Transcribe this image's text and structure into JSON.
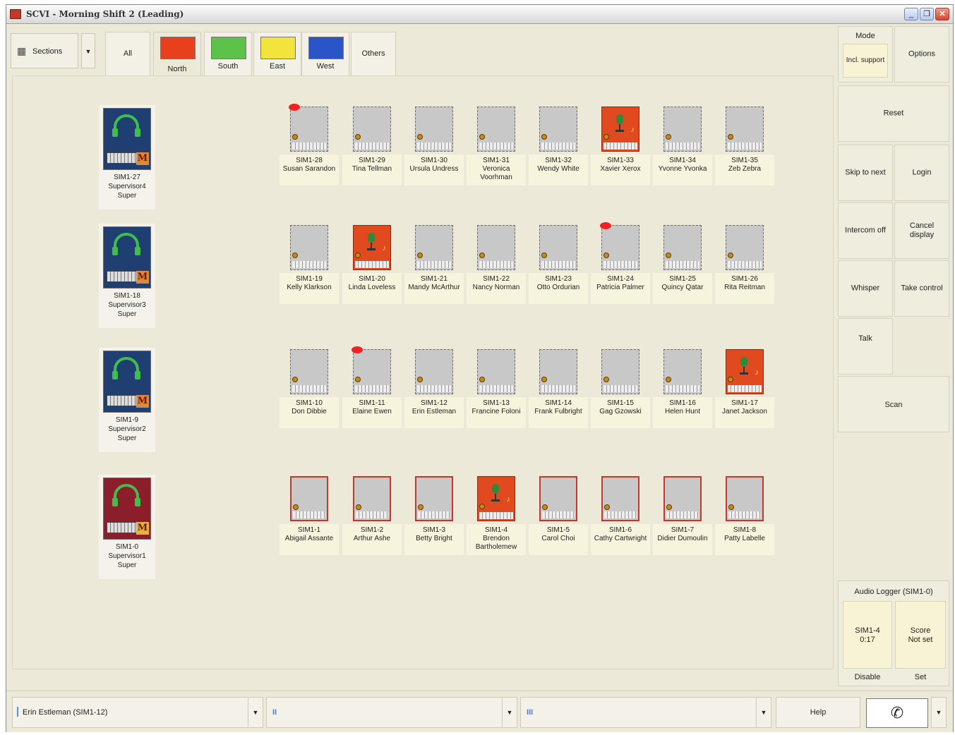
{
  "window": {
    "title": "SCVI - Morning Shift 2 (Leading)",
    "controls": [
      "_",
      "❐",
      "✕"
    ]
  },
  "toolbar": {
    "sections_label": "Sections",
    "tabs": [
      {
        "label": "All",
        "color": ""
      },
      {
        "label": "North",
        "color": "#e8401c"
      },
      {
        "label": "South",
        "color": "#5cc24a"
      },
      {
        "label": "East",
        "color": "#f2e43a"
      },
      {
        "label": "West",
        "color": "#2a55c8"
      },
      {
        "label": "Others",
        "color": ""
      }
    ],
    "active_tab": "North"
  },
  "supervisors": [
    {
      "id": "SIM1-27",
      "name": "Supervisor4",
      "role": "Super"
    },
    {
      "id": "SIM1-18",
      "name": "Supervisor3",
      "role": "Super"
    },
    {
      "id": "SIM1-9",
      "name": "Supervisor2",
      "role": "Super"
    },
    {
      "id": "SIM1-0",
      "name": "Supervisor1",
      "role": "Super"
    }
  ],
  "agent_rows": [
    [
      {
        "id": "SIM1-28",
        "name": "Susan Sarandon",
        "state": "idle",
        "badge": true
      },
      {
        "id": "SIM1-29",
        "name": "Tina Tellman",
        "state": "idle",
        "badge": false
      },
      {
        "id": "SIM1-30",
        "name": "Ursula Undress",
        "state": "idle",
        "badge": false
      },
      {
        "id": "SIM1-31",
        "name": "Veronica Voorhman",
        "state": "idle",
        "badge": false
      },
      {
        "id": "SIM1-32",
        "name": "Wendy White",
        "state": "idle",
        "badge": false
      },
      {
        "id": "SIM1-33",
        "name": "Xavier Xerox",
        "state": "talking",
        "badge": false
      },
      {
        "id": "SIM1-34",
        "name": "Yvonne Yvonka",
        "state": "idle",
        "badge": false
      },
      {
        "id": "SIM1-35",
        "name": "Zeb Zebra",
        "state": "idle",
        "badge": false
      }
    ],
    [
      {
        "id": "SIM1-19",
        "name": "Kelly Klarkson",
        "state": "idle",
        "badge": false
      },
      {
        "id": "SIM1-20",
        "name": "Linda Loveless",
        "state": "talking",
        "badge": false
      },
      {
        "id": "SIM1-21",
        "name": "Mandy McArthur",
        "state": "idle",
        "badge": false
      },
      {
        "id": "SIM1-22",
        "name": "Nancy Norman",
        "state": "idle",
        "badge": false
      },
      {
        "id": "SIM1-23",
        "name": "Otto Ordurian",
        "state": "idle",
        "badge": false
      },
      {
        "id": "SIM1-24",
        "name": "Patricia Palmer",
        "state": "idle",
        "badge": true
      },
      {
        "id": "SIM1-25",
        "name": "Quincy Qatar",
        "state": "idle",
        "badge": false
      },
      {
        "id": "SIM1-26",
        "name": "Rita Reitman",
        "state": "idle",
        "badge": false
      }
    ],
    [
      {
        "id": "SIM1-10",
        "name": "Don Dibbie",
        "state": "idle",
        "badge": false
      },
      {
        "id": "SIM1-11",
        "name": "Elaine Ewen",
        "state": "idle",
        "badge": true
      },
      {
        "id": "SIM1-12",
        "name": "Erin Estleman",
        "state": "idle",
        "badge": false
      },
      {
        "id": "SIM1-13",
        "name": "Francine Foloni",
        "state": "idle",
        "badge": false
      },
      {
        "id": "SIM1-14",
        "name": "Frank Fulbright",
        "state": "idle",
        "badge": false
      },
      {
        "id": "SIM1-15",
        "name": "Gag Gzowski",
        "state": "idle",
        "badge": false
      },
      {
        "id": "SIM1-16",
        "name": "Helen Hunt",
        "state": "idle",
        "badge": false
      },
      {
        "id": "SIM1-17",
        "name": "Janet Jackson",
        "state": "talking",
        "badge": false
      }
    ],
    [
      {
        "id": "SIM1-1",
        "name": "Abigail Assante",
        "state": "selected",
        "badge": false
      },
      {
        "id": "SIM1-2",
        "name": "Arthur Ashe",
        "state": "selected",
        "badge": false
      },
      {
        "id": "SIM1-3",
        "name": "Betty Bright",
        "state": "selected",
        "badge": false
      },
      {
        "id": "SIM1-4",
        "name": "Brendon Bartholemew",
        "state": "talking",
        "badge": false
      },
      {
        "id": "SIM1-5",
        "name": "Carol Choi",
        "state": "selected",
        "badge": false
      },
      {
        "id": "SIM1-6",
        "name": "Cathy Cartwright",
        "state": "selected",
        "badge": false
      },
      {
        "id": "SIM1-7",
        "name": "Didier Dumoulin",
        "state": "selected",
        "badge": false
      },
      {
        "id": "SIM1-8",
        "name": "Patty Labelle",
        "state": "selected",
        "badge": false
      }
    ]
  ],
  "right_panel": {
    "mode_label": "Mode",
    "mode_value": "Incl. support",
    "options": "Options",
    "reset": "Reset",
    "skip_to_next": "Skip to next",
    "login": "Login",
    "intercom_off": "Intercom off",
    "cancel_display": "Cancel display",
    "whisper": "Whisper",
    "take_control": "Take control",
    "talk": "Talk",
    "scan": "Scan",
    "audio_logger_title": "Audio Logger (SIM1-0)",
    "logger_agent": "SIM1-4",
    "logger_time": "0:17",
    "score_label": "Score",
    "score_value": "Not set",
    "disable": "Disable",
    "set": "Set"
  },
  "status_bar": {
    "agent_select": "Erin Estleman (SIM1-12)",
    "line2": "II",
    "line3": "III",
    "help": "Help"
  }
}
